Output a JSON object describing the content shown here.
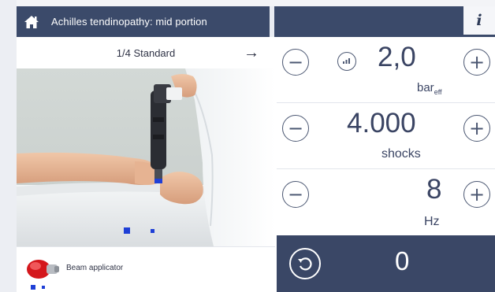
{
  "header": {
    "title": "Achilles tendinopathy: mid portion",
    "info_label": "i",
    "home_icon": "home-icon"
  },
  "step": {
    "label": "1/4 Standard",
    "next_arrow": "→"
  },
  "applicator": {
    "label": "Beam applicator",
    "icon": "beam-applicator-icon"
  },
  "parameters": {
    "pressure": {
      "value": "2,0",
      "unit": "bar",
      "unit_sub": "eff",
      "minus": "−",
      "plus": "+"
    },
    "shocks": {
      "value": "4.000",
      "unit": "shocks",
      "minus": "−",
      "plus": "+"
    },
    "frequency": {
      "value": "8",
      "unit": "Hz",
      "minus": "−",
      "plus": "+"
    }
  },
  "counter": {
    "value": "0",
    "reset_icon": "reset-icon"
  },
  "colors": {
    "header_bg": "#3b4a6a",
    "accent_blue": "#1e3fd6",
    "text_dark": "#3a4463"
  }
}
